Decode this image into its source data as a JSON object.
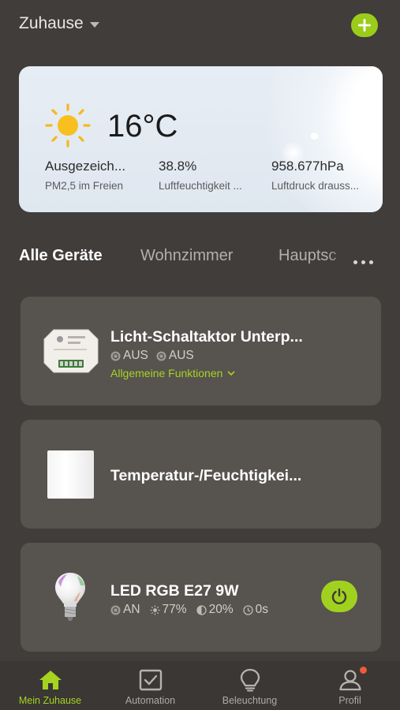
{
  "header": {
    "home_title": "Zuhause",
    "add_label": "+"
  },
  "weather": {
    "temperature": "16°C",
    "items": [
      {
        "value": "Ausgezeich...",
        "label": "PM2,5 im Freien"
      },
      {
        "value": "38.8%",
        "label": "Luftfeuchtigkeit ..."
      },
      {
        "value": "958.677hPa",
        "label": "Luftdruck drauss..."
      }
    ]
  },
  "tabs": [
    {
      "label": "Alle Geräte",
      "active": true
    },
    {
      "label": "Wohnzimmer",
      "active": false
    },
    {
      "label": "Hauptsc",
      "active": false
    }
  ],
  "devices": [
    {
      "name": "Licht-Schaltaktor Unterp...",
      "status": [
        "AUS",
        "AUS"
      ],
      "function_link": "Allgemeine Funktionen"
    },
    {
      "name": "Temperatur-/Feuchtigkei..."
    },
    {
      "name": "LED RGB E27 9W",
      "status": {
        "power": "AN",
        "brightness": "77%",
        "contrast": "20%",
        "timer": "0s"
      }
    }
  ],
  "bottom_nav": [
    {
      "label": "Mein Zuhause",
      "icon": "home-icon",
      "active": true
    },
    {
      "label": "Automation",
      "icon": "checkbox-icon",
      "active": false
    },
    {
      "label": "Beleuchtung",
      "icon": "bulb-icon",
      "active": false
    },
    {
      "label": "Profil",
      "icon": "profile-icon",
      "active": false
    }
  ],
  "colors": {
    "background": "#403d3b",
    "card": "#57534f",
    "accent": "#a1d11f",
    "badge": "#ee5a3a"
  }
}
